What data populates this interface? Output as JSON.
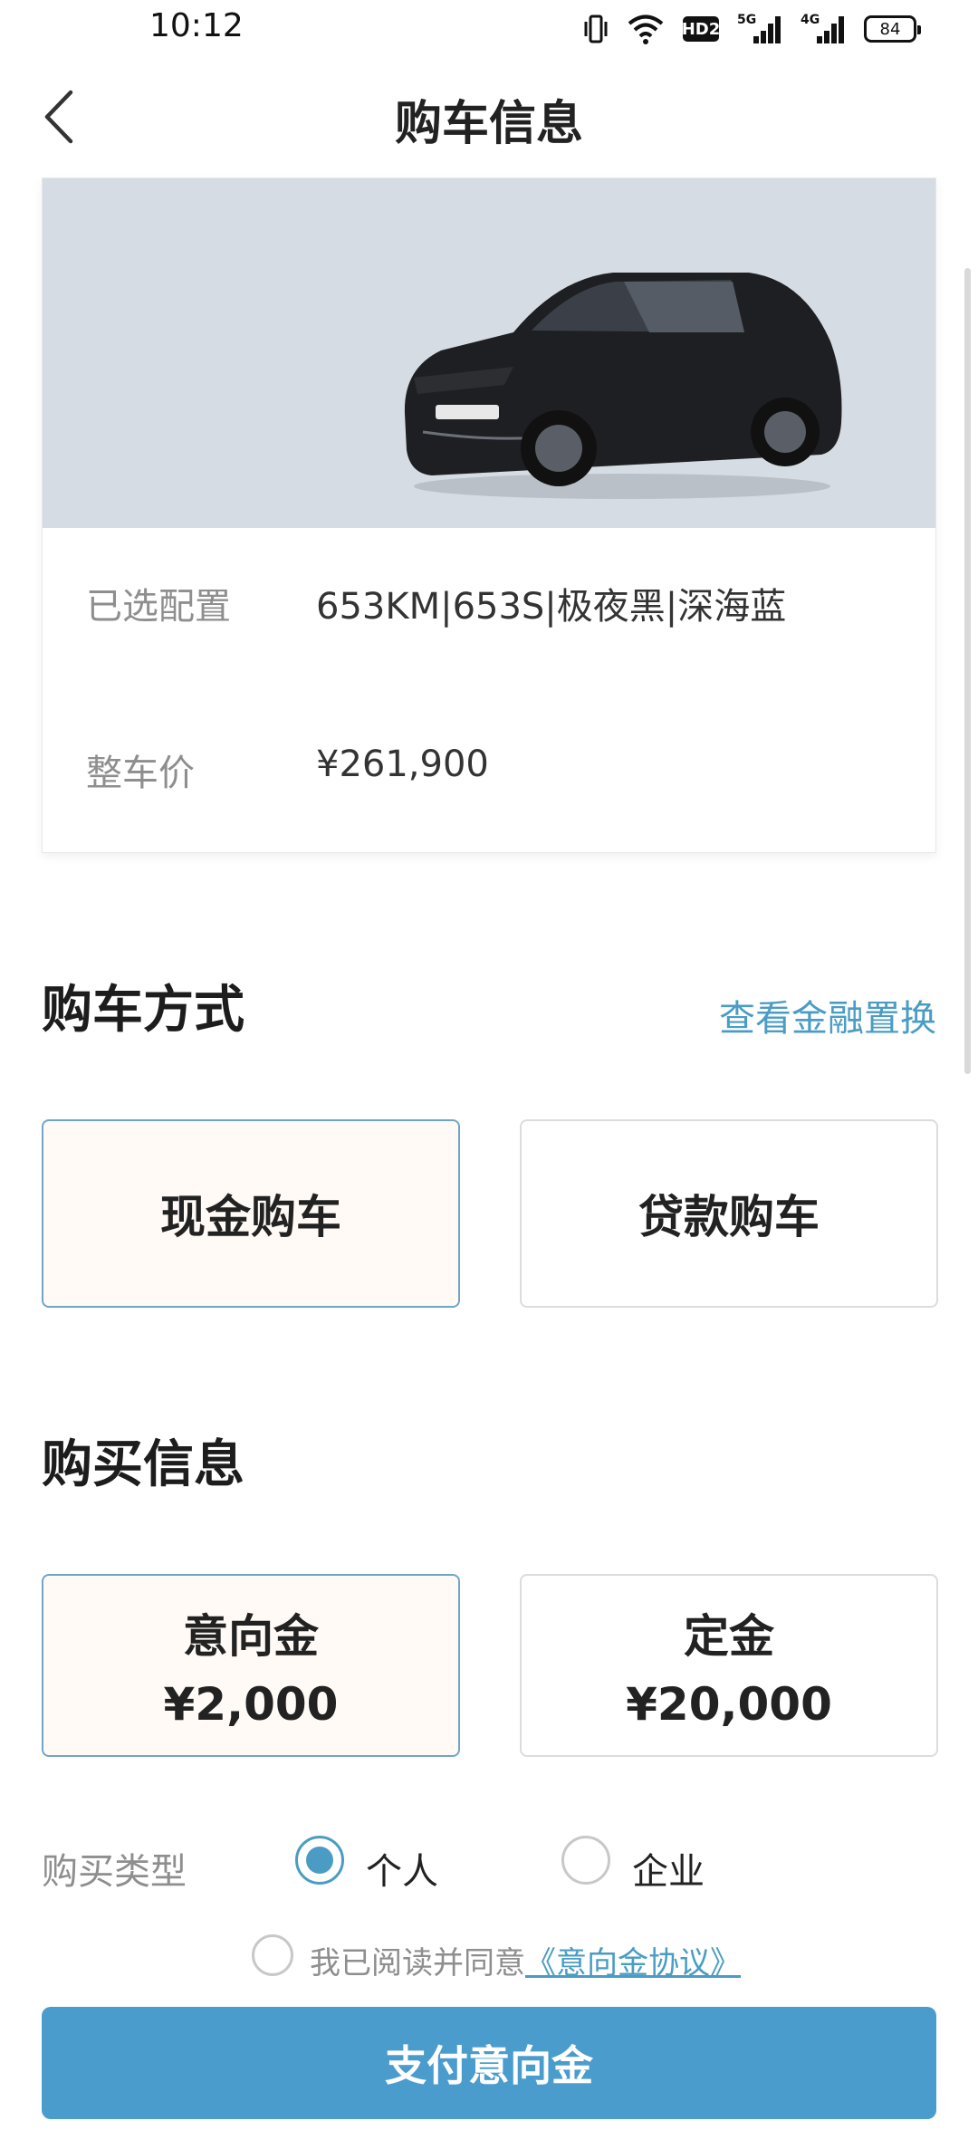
{
  "status_bar": {
    "time": "10:12",
    "hd_label": "HD2",
    "signal_1_label": "5G",
    "signal_2_label": "4G",
    "battery": "84"
  },
  "header": {
    "title": "购车信息",
    "back_icon": "chevron-left-icon"
  },
  "car_card": {
    "config_label": "已选配置",
    "config_value": "653KM|653S|极夜黑|深海蓝",
    "price_label": "整车价",
    "price_value": "¥261,900"
  },
  "purchase_method": {
    "title": "购车方式",
    "finance_link": "查看金融置换",
    "options": [
      {
        "label": "现金购车",
        "selected": true
      },
      {
        "label": "贷款购车",
        "selected": false
      }
    ]
  },
  "purchase_info": {
    "title": "购买信息",
    "options": [
      {
        "label": "意向金",
        "amount": "¥2,000",
        "selected": true
      },
      {
        "label": "定金",
        "amount": "¥20,000",
        "selected": false
      }
    ],
    "type_label": "购买类型",
    "types": [
      {
        "label": "个人",
        "checked": true
      },
      {
        "label": "企业",
        "checked": false
      }
    ]
  },
  "agreement": {
    "text": "我已阅读并同意",
    "link": "《意向金协议》",
    "checked": false
  },
  "pay_button": {
    "label": "支付意向金"
  },
  "colors": {
    "accent": "#4a9ccd",
    "link": "#4a9cc4",
    "car_bg": "#d6dce3"
  }
}
